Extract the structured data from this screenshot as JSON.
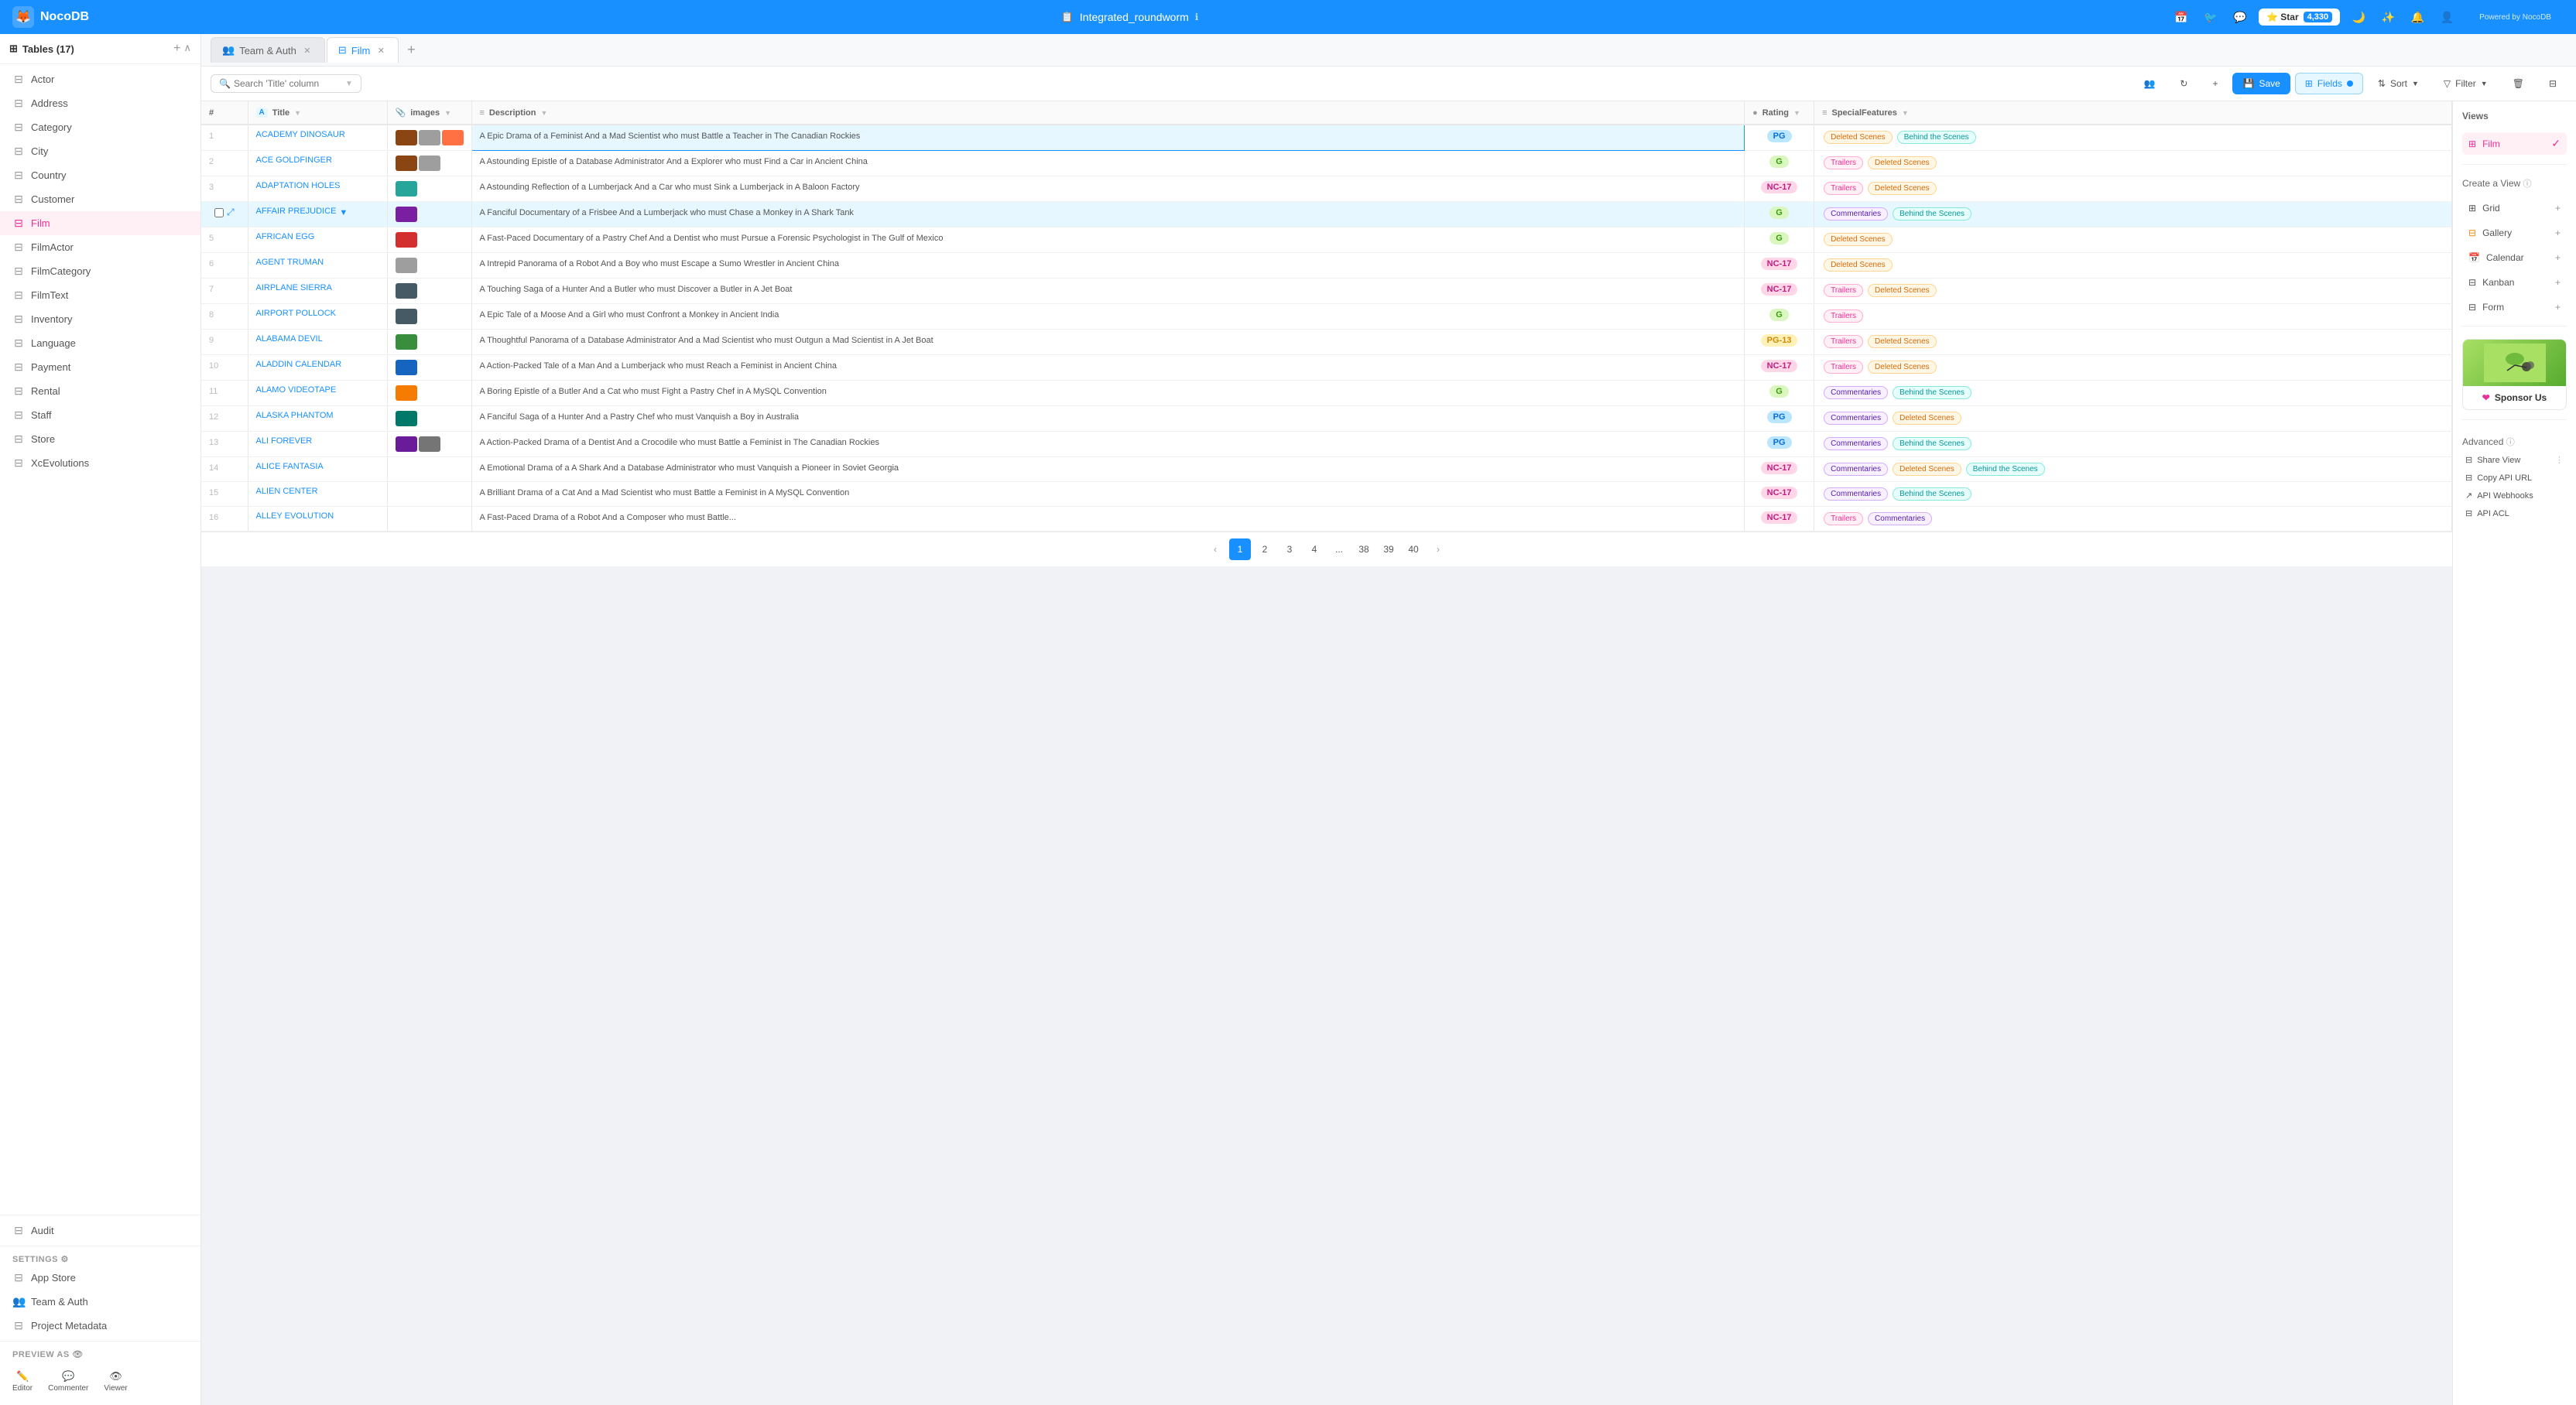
{
  "app": {
    "name": "NocoDB",
    "db_name": "Integrated_roundworm",
    "powered_by": "Powered by NocoDB",
    "star_count": "4,330"
  },
  "tabs": [
    {
      "label": "Team & Auth",
      "active": false,
      "closable": true
    },
    {
      "label": "Film",
      "active": true,
      "closable": true
    }
  ],
  "toolbar": {
    "search_placeholder": "Search 'Title' column",
    "save_label": "Save",
    "fields_label": "Fields",
    "sort_label": "Sort",
    "filter_label": "Filter"
  },
  "columns": [
    {
      "label": "#",
      "icon": ""
    },
    {
      "label": "Title",
      "icon": "A"
    },
    {
      "label": "images",
      "icon": "📎"
    },
    {
      "label": "Description",
      "icon": "≡"
    },
    {
      "label": "Rating",
      "icon": "●"
    },
    {
      "label": "SpecialFeatures",
      "icon": "≡"
    }
  ],
  "rows": [
    {
      "num": 1,
      "title": "ACADEMY DINOSAUR",
      "images": [
        "brown",
        "gray",
        "orange"
      ],
      "desc": "A Epic Drama of a Feminist And a Mad Scientist who must Battle a Teacher in The Canadian Rockies",
      "rating": "PG",
      "tags": [
        "Deleted Scenes",
        "Behind the Scenes"
      ]
    },
    {
      "num": 2,
      "title": "ACE GOLDFINGER",
      "images": [
        "brown",
        "gray"
      ],
      "desc": "A Astounding Epistle of a Database Administrator And a Explorer who must Find a Car in Ancient China",
      "rating": "G",
      "tags": [
        "Trailers",
        "Deleted Scenes"
      ]
    },
    {
      "num": 3,
      "title": "ADAPTATION HOLES",
      "images": [
        "teal"
      ],
      "desc": "A Astounding Reflection of a Lumberjack And a Car who must Sink a Lumberjack in A Baloon Factory",
      "rating": "NC-17",
      "tags": [
        "Trailers",
        "Deleted Scenes"
      ]
    },
    {
      "num": 4,
      "title": "AFFAIR PREJUDICE",
      "images": [
        "purple"
      ],
      "desc": "A Fanciful Documentary of a Frisbee And a Lumberjack who must Chase a Monkey in A Shark Tank",
      "rating": "G",
      "tags": [
        "Commentaries",
        "Behind the Scenes"
      ]
    },
    {
      "num": 5,
      "title": "AFRICAN EGG",
      "images": [
        "red"
      ],
      "desc": "A Fast-Paced Documentary of a Pastry Chef And a Dentist who must Pursue a Forensic Psychologist in The Gulf of Mexico",
      "rating": "G",
      "tags": [
        "Deleted Scenes"
      ]
    },
    {
      "num": 6,
      "title": "AGENT TRUMAN",
      "images": [
        "gray"
      ],
      "desc": "A Intrepid Panorama of a Robot And a Boy who must Escape a Sumo Wrestler in Ancient China",
      "rating": "NC-17",
      "tags": [
        "Deleted Scenes"
      ]
    },
    {
      "num": 7,
      "title": "AIRPLANE SIERRA",
      "images": [
        "dark"
      ],
      "desc": "A Touching Saga of a Hunter And a Butler who must Discover a Butler in A Jet Boat",
      "rating": "NC-17",
      "tags": [
        "Trailers",
        "Deleted Scenes"
      ]
    },
    {
      "num": 8,
      "title": "AIRPORT POLLOCK",
      "images": [
        "dark"
      ],
      "desc": "A Epic Tale of a Moose And a Girl who must Confront a Monkey in Ancient India",
      "rating": "G",
      "tags": [
        "Trailers"
      ]
    },
    {
      "num": 9,
      "title": "ALABAMA DEVIL",
      "images": [
        "green"
      ],
      "desc": "A Thoughtful Panorama of a Database Administrator And a Mad Scientist who must Outgun a Mad Scientist in A Jet Boat",
      "rating": "PG-13",
      "tags": [
        "Trailers",
        "Deleted Scenes"
      ]
    },
    {
      "num": 10,
      "title": "ALADDIN CALENDAR",
      "images": [
        "blue"
      ],
      "desc": "A Action-Packed Tale of a Man And a Lumberjack who must Reach a Feminist in Ancient China",
      "rating": "NC-17",
      "tags": [
        "Trailers",
        "Deleted Scenes"
      ]
    },
    {
      "num": 11,
      "title": "ALAMO VIDEOTAPE",
      "images": [
        "orange2"
      ],
      "desc": "A Boring Epistle of a Butler And a Cat who must Fight a Pastry Chef in A MySQL Convention",
      "rating": "G",
      "tags": [
        "Commentaries",
        "Behind the Scenes"
      ]
    },
    {
      "num": 12,
      "title": "ALASKA PHANTOM",
      "images": [
        "teal2"
      ],
      "desc": "A Fanciful Saga of a Hunter And a Pastry Chef who must Vanquish a Boy in Australia",
      "rating": "PG",
      "tags": [
        "Commentaries",
        "Deleted Scenes"
      ]
    },
    {
      "num": 13,
      "title": "ALI FOREVER",
      "images": [
        "purple2",
        "gray2"
      ],
      "desc": "A Action-Packed Drama of a Dentist And a Crocodile who must Battle a Feminist in The Canadian Rockies",
      "rating": "PG",
      "tags": [
        "Commentaries",
        "Behind the Scenes"
      ]
    },
    {
      "num": 14,
      "title": "ALICE FANTASIA",
      "images": [],
      "desc": "A Emotional Drama of a A Shark And a Database Administrator who must Vanquish a Pioneer in Soviet Georgia",
      "rating": "NC-17",
      "tags": [
        "Commentaries",
        "Deleted Scenes",
        "Behind the Scenes"
      ]
    },
    {
      "num": 15,
      "title": "ALIEN CENTER",
      "images": [],
      "desc": "A Brilliant Drama of a Cat And a Mad Scientist who must Battle a Feminist in A MySQL Convention",
      "rating": "NC-17",
      "tags": [
        "Commentaries",
        "Behind the Scenes"
      ]
    },
    {
      "num": 16,
      "title": "ALLEY EVOLUTION",
      "images": [],
      "desc": "A Fast-Paced Drama of a Robot And a Composer who must Battle...",
      "rating": "NC-17",
      "tags": [
        "Trailers",
        "Commentaries"
      ]
    }
  ],
  "views": {
    "title": "Views",
    "active": "Film",
    "items": [
      {
        "label": "Film",
        "icon": "grid"
      }
    ]
  },
  "create_view": {
    "title": "Create a View",
    "items": [
      {
        "label": "Grid"
      },
      {
        "label": "Gallery"
      },
      {
        "label": "Calendar"
      },
      {
        "label": "Kanban"
      },
      {
        "label": "Form"
      }
    ]
  },
  "sponsor": {
    "label": "Sponsor Us"
  },
  "advanced": {
    "title": "Advanced",
    "items": [
      {
        "label": "Share View"
      },
      {
        "label": "Copy API URL"
      },
      {
        "label": "API Webhooks"
      },
      {
        "label": "API ACL"
      }
    ]
  },
  "pagination": {
    "current": 1,
    "pages": [
      "1",
      "2",
      "3",
      "4",
      "...",
      "38",
      "39",
      "40"
    ]
  },
  "sidebar": {
    "header": "Tables (17)",
    "items": [
      {
        "label": "Actor"
      },
      {
        "label": "Address"
      },
      {
        "label": "Category"
      },
      {
        "label": "City"
      },
      {
        "label": "Country"
      },
      {
        "label": "Customer"
      },
      {
        "label": "Film",
        "active": true
      },
      {
        "label": "FilmActor"
      },
      {
        "label": "FilmCategory"
      },
      {
        "label": "FilmText"
      },
      {
        "label": "Inventory"
      },
      {
        "label": "Language"
      },
      {
        "label": "Payment"
      },
      {
        "label": "Rental"
      },
      {
        "label": "Staff"
      },
      {
        "label": "Store"
      },
      {
        "label": "XcEvolutions"
      }
    ],
    "footer": [
      {
        "label": "Audit"
      }
    ],
    "settings": {
      "label": "Settings",
      "items": [
        {
          "label": "App Store"
        },
        {
          "label": "Team & Auth"
        },
        {
          "label": "Project Metadata"
        }
      ]
    },
    "preview": {
      "label": "Preview as",
      "items": [
        {
          "label": "Editor"
        },
        {
          "label": "Commenter"
        },
        {
          "label": "Viewer"
        }
      ]
    }
  }
}
